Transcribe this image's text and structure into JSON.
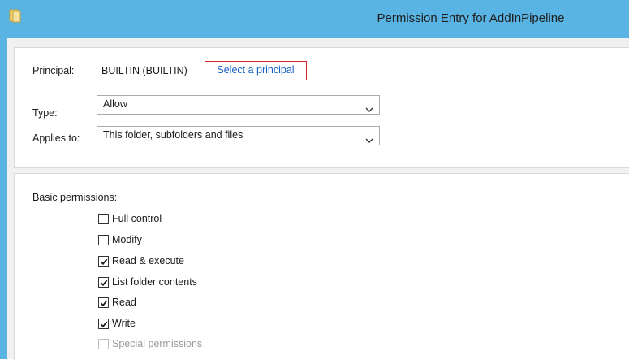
{
  "window": {
    "title": "Permission Entry for AddInPipeline"
  },
  "principal": {
    "label": "Principal:",
    "value": "BUILTIN (BUILTIN)",
    "link_label": "Select a principal"
  },
  "type": {
    "label": "Type:",
    "value": "Allow"
  },
  "applies_to": {
    "label": "Applies to:",
    "value": "This folder, subfolders and files"
  },
  "basic_permissions": {
    "label": "Basic permissions:",
    "items": [
      {
        "label": "Full control",
        "checked": false,
        "enabled": true
      },
      {
        "label": "Modify",
        "checked": false,
        "enabled": true
      },
      {
        "label": "Read & execute",
        "checked": true,
        "enabled": true
      },
      {
        "label": "List folder contents",
        "checked": true,
        "enabled": true
      },
      {
        "label": "Read",
        "checked": true,
        "enabled": true
      },
      {
        "label": "Write",
        "checked": true,
        "enabled": true
      },
      {
        "label": "Special permissions",
        "checked": false,
        "enabled": false
      }
    ]
  },
  "colors": {
    "titlebar": "#5ab4e3",
    "link": "#1460c8",
    "highlight_border": "#e0202a"
  }
}
